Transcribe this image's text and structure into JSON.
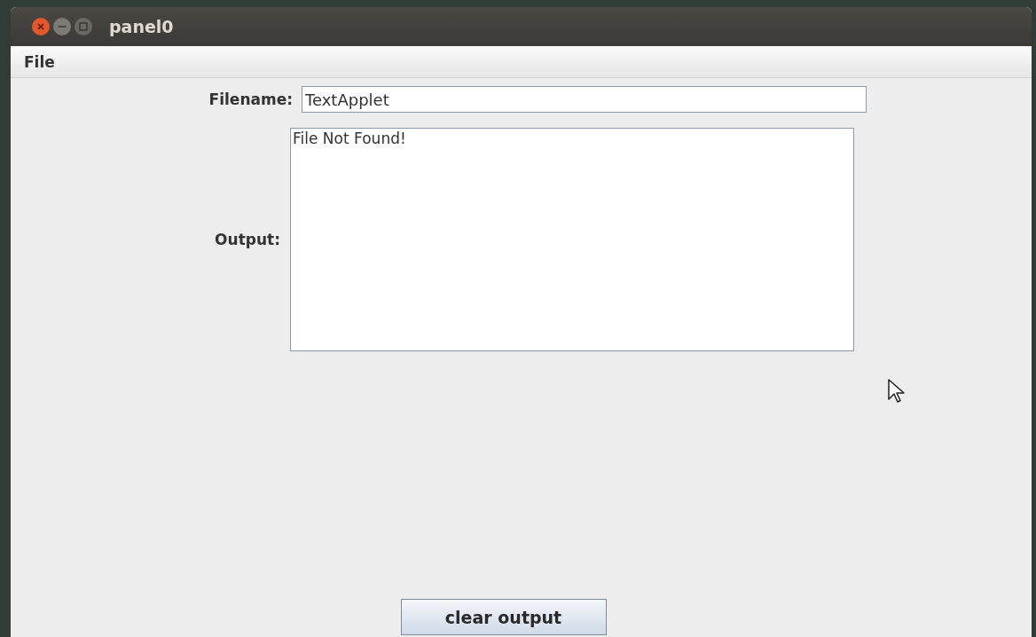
{
  "window": {
    "title": "panel0"
  },
  "menu_bar": {
    "items": [
      {
        "label": "File"
      }
    ]
  },
  "form": {
    "filename": {
      "label": "Filename:",
      "value": "TextApplet"
    },
    "output": {
      "label": "Output:",
      "value": "File Not Found!"
    }
  },
  "buttons": [
    {
      "label": "clear output"
    }
  ]
}
